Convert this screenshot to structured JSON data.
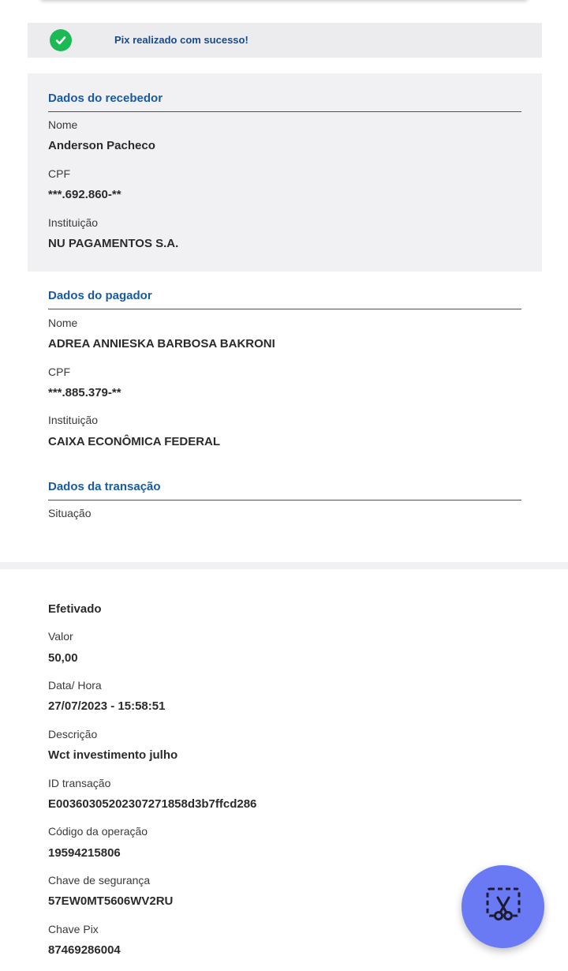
{
  "banner": {
    "message": "Pix realizado com sucesso!"
  },
  "receiver": {
    "title": "Dados do recebedor",
    "name_label": "Nome",
    "name_value": "Anderson Pacheco",
    "cpf_label": "CPF",
    "cpf_value": "***.692.860-**",
    "institution_label": "Instituição",
    "institution_value": "NU PAGAMENTOS S.A."
  },
  "payer": {
    "title": "Dados do pagador",
    "name_label": "Nome",
    "name_value": "ADREA ANNIESKA BARBOSA BAKRONI",
    "cpf_label": "CPF",
    "cpf_value": "***.885.379-**",
    "institution_label": "Instituição",
    "institution_value": "CAIXA ECONÔMICA FEDERAL"
  },
  "transaction": {
    "title": "Dados da transação",
    "status_label": "Situação",
    "status_value": "Efetivado",
    "amount_label": "Valor",
    "amount_value": "50,00",
    "datetime_label": "Data/ Hora",
    "datetime_value": "27/07/2023 - 15:58:51",
    "description_label": "Descrição",
    "description_value": "Wct investimento julho",
    "transaction_id_label": "ID transação",
    "transaction_id_value": "E00360305202307271858d3b7ffcd286",
    "operation_code_label": "Código da operação",
    "operation_code_value": "19594215806",
    "security_key_label": "Chave de segurança",
    "security_key_value": "57EW0MT5606WV2RU",
    "pix_key_label": "Chave Pix",
    "pix_key_value": "87469286004"
  },
  "fab": {
    "icon": "screenshot-cut-icon",
    "color": "#6a7af4"
  },
  "colors": {
    "accent": "#1a5aa0",
    "success": "#1db954",
    "panel": "#f1f1f3"
  }
}
